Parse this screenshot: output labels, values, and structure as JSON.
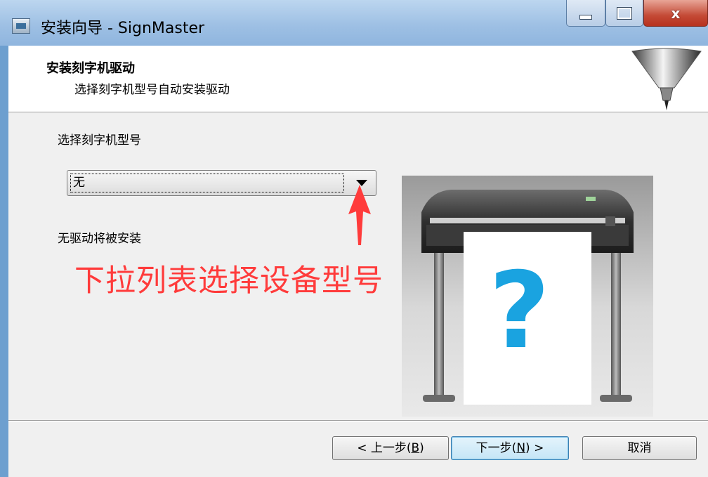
{
  "window": {
    "title": "安装向导 - SignMaster",
    "close_glyph": "x"
  },
  "header": {
    "title": "安装刻字机驱动",
    "subtitle": "选择刻字机型号自动安装驱动"
  },
  "main": {
    "select_label": "选择刻字机型号",
    "model_select": {
      "value": "无"
    },
    "status": "无驱动将被安装",
    "annotation": "下拉列表选择设备型号",
    "preview_symbol": "?"
  },
  "buttons": {
    "back": {
      "prefix": "< 上一步(",
      "key": "B",
      "suffix": ")"
    },
    "next": {
      "prefix": "下一步(",
      "key": "N",
      "suffix": ") >"
    },
    "cancel": "取消"
  },
  "colors": {
    "annotation": "#ff3b3b",
    "question_mark": "#1aa3e0",
    "close_button": "#c44a36"
  },
  "icons": [
    "app-icon",
    "minimize-icon",
    "maximize-icon",
    "close-icon",
    "cutter-blade-icon",
    "dropdown-arrow-icon",
    "red-arrow-annotation-icon",
    "plotter-illustration"
  ]
}
